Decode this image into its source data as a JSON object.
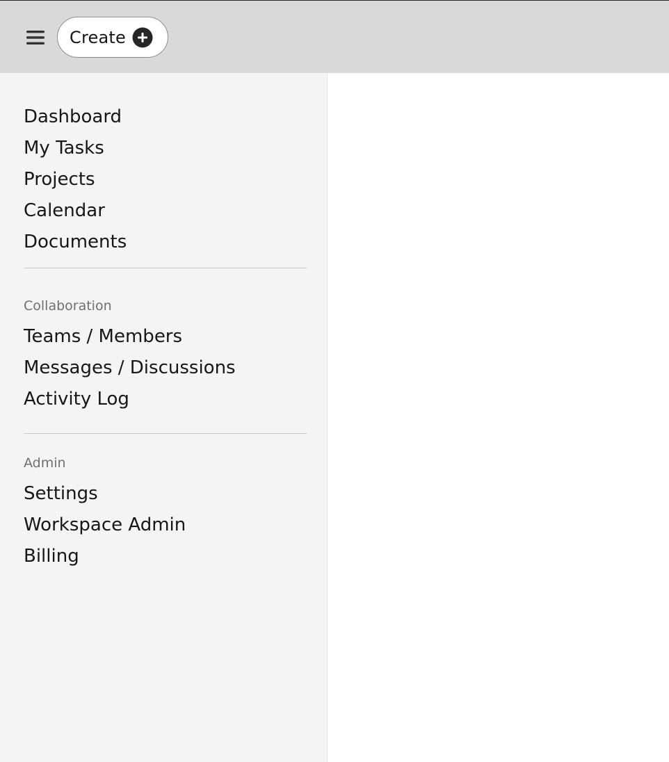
{
  "header": {
    "menu_icon": "hamburger-menu-icon",
    "create_label": "Create",
    "create_icon": "add-filled-circle-icon"
  },
  "sidebar": {
    "primary_items": [
      {
        "label": "Dashboard"
      },
      {
        "label": "My Tasks"
      },
      {
        "label": "Projects"
      },
      {
        "label": "Calendar"
      },
      {
        "label": "Documents"
      }
    ],
    "collaboration": {
      "heading": "Collaboration",
      "items": [
        {
          "label": "Teams / Members"
        },
        {
          "label": "Messages / Discussions"
        },
        {
          "label": "Activity Log"
        }
      ]
    },
    "admin": {
      "heading": "Admin",
      "items": [
        {
          "label": "Settings"
        },
        {
          "label": "Workspace Admin"
        },
        {
          "label": "Billing"
        }
      ]
    }
  },
  "colors": {
    "header_bg": "#d9d9d9",
    "sidebar_bg": "#f4f4f4",
    "text": "#161616",
    "muted_text": "#6f6f6f"
  }
}
